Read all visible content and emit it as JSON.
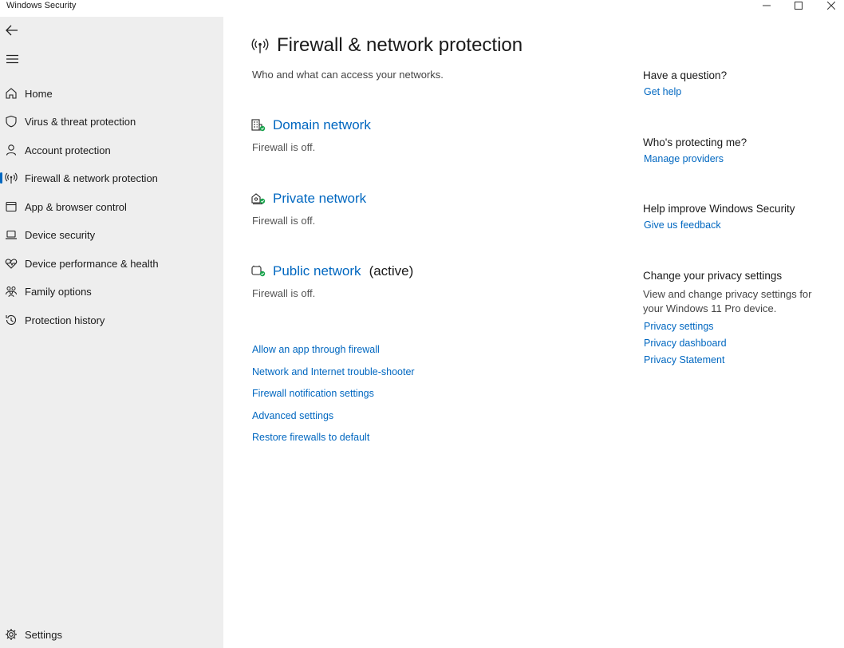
{
  "window": {
    "title": "Windows Security",
    "controls": {
      "minimize": "minimize-icon",
      "maximize": "maximize-icon",
      "close": "close-icon"
    }
  },
  "sidebar": {
    "back_icon": "back-arrow-icon",
    "menu_icon": "hamburger-menu-icon",
    "items": [
      {
        "label": "Home",
        "icon": "home-icon"
      },
      {
        "label": "Virus & threat protection",
        "icon": "shield-icon"
      },
      {
        "label": "Account protection",
        "icon": "person-icon"
      },
      {
        "label": "Firewall & network protection",
        "icon": "wifi-antenna-icon",
        "selected": true
      },
      {
        "label": "App & browser control",
        "icon": "app-window-icon"
      },
      {
        "label": "Device security",
        "icon": "laptop-icon"
      },
      {
        "label": "Device performance & health",
        "icon": "heart-pulse-icon"
      },
      {
        "label": "Family options",
        "icon": "family-icon"
      },
      {
        "label": "Protection history",
        "icon": "history-icon"
      }
    ],
    "settings": {
      "label": "Settings",
      "icon": "gear-icon"
    }
  },
  "main": {
    "title": "Firewall & network protection",
    "subtitle": "Who and what can access your networks.",
    "networks": [
      {
        "name": "Domain network",
        "status": "Firewall is off.",
        "active_label": "",
        "icon": "domain-network-icon"
      },
      {
        "name": "Private network",
        "status": "Firewall is off.",
        "active_label": "",
        "icon": "private-network-icon"
      },
      {
        "name": "Public network",
        "status": "Firewall is off.",
        "active_label": "(active)",
        "icon": "public-network-icon"
      }
    ],
    "links": [
      "Allow an app through firewall",
      "Network and Internet trouble-shooter",
      "Firewall notification settings",
      "Advanced settings",
      "Restore firewalls to default"
    ]
  },
  "right": {
    "question": {
      "heading": "Have a question?",
      "link": "Get help"
    },
    "protecting": {
      "heading": "Who's protecting me?",
      "link": "Manage providers"
    },
    "improve": {
      "heading": "Help improve Windows Security",
      "link": "Give us feedback"
    },
    "privacy": {
      "heading": "Change your privacy settings",
      "body": "View and change privacy settings for your Windows 11 Pro device.",
      "links": [
        "Privacy settings",
        "Privacy dashboard",
        "Privacy Statement"
      ]
    }
  },
  "colors": {
    "accent": "#0067c0",
    "sidebar_bg": "#eeeeee",
    "status_ok": "#16a34a"
  }
}
